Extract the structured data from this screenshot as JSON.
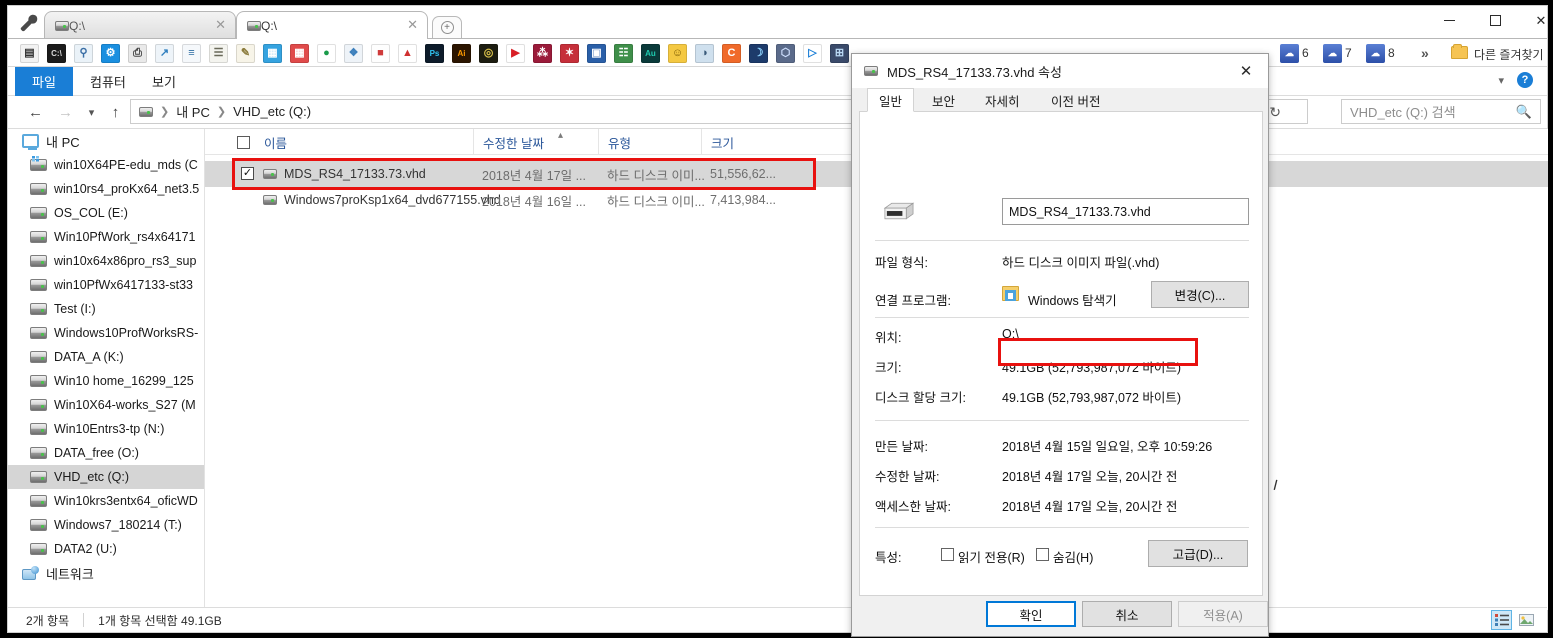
{
  "window": {
    "controls": {
      "minimize": "minimize-icon",
      "maximize": "maximize-icon",
      "close": "close-icon"
    }
  },
  "tabs": [
    {
      "label": "Q:\\",
      "active": false
    },
    {
      "label": "Q:\\",
      "active": true
    }
  ],
  "bookmarks": {
    "numbered": [
      "6",
      "7",
      "8"
    ],
    "overflow_label": "»",
    "other_folder_label": "다른 즐겨찾기"
  },
  "quicklaunch_icons": [
    "calculator-icon",
    "command-prompt-icon",
    "magnifier-icon",
    "process-explorer-icon",
    "printer-icon",
    "monitor-chart-icon",
    "spreadsheet-icon",
    "notepad-icon",
    "wordpad-icon",
    "blue-grid-icon",
    "red-grid-icon",
    "chrome-icon",
    "paint-icon",
    "media-icon",
    "pdf-icon",
    "photoshop-icon",
    "illustrator-icon",
    "camera-raw-icon",
    "play-icon",
    "app-icon-1",
    "app-icon-2",
    "snapshot-icon",
    "imaging-icon",
    "audition-icon",
    "emoji-icon",
    "globe-icon",
    "ccleaner-icon",
    "moon-icon",
    "cube-icon",
    "player-icon",
    "utility-icon"
  ],
  "ribbon": {
    "tabs": [
      {
        "label": "파일",
        "active": true
      },
      {
        "label": "컴퓨터",
        "active": false
      },
      {
        "label": "보기",
        "active": false
      }
    ],
    "help_icon": "help-icon",
    "expand_icon": "chevron-down-icon"
  },
  "address": {
    "back_icon": "back-arrow-icon",
    "forward_icon": "forward-arrow-icon",
    "history_icon": "chevron-down-icon",
    "up_icon": "up-arrow-icon",
    "breadcrumbs": [
      "내 PC",
      "VHD_etc (Q:)"
    ],
    "refresh_icon": "refresh-icon",
    "dropdown_icon": "chevron-down-icon",
    "search_placeholder": "VHD_etc (Q:) 검색",
    "search_icon": "search-icon"
  },
  "navpane": {
    "items": [
      {
        "label": "내 PC",
        "icon": "pc-icon",
        "kind": "root",
        "selected": false
      },
      {
        "label": "win10X64PE-edu_mds (C",
        "icon": "system-drive-icon",
        "kind": "drive",
        "selected": false
      },
      {
        "label": "win10rs4_proKx64_net3.5",
        "icon": "drive-icon",
        "kind": "drive",
        "selected": false
      },
      {
        "label": "OS_COL (E:)",
        "icon": "drive-icon",
        "kind": "drive",
        "selected": false
      },
      {
        "label": "Win10PfWork_rs4x64171",
        "icon": "drive-icon",
        "kind": "drive",
        "selected": false
      },
      {
        "label": "win10x64x86pro_rs3_sup",
        "icon": "drive-icon",
        "kind": "drive",
        "selected": false
      },
      {
        "label": "win10PfWx6417133-st33",
        "icon": "drive-icon",
        "kind": "drive",
        "selected": false
      },
      {
        "label": "Test (I:)",
        "icon": "drive-icon",
        "kind": "drive",
        "selected": false
      },
      {
        "label": "Windows10ProfWorksRS-",
        "icon": "drive-icon",
        "kind": "drive",
        "selected": false
      },
      {
        "label": "DATA_A (K:)",
        "icon": "drive-icon",
        "kind": "drive",
        "selected": false
      },
      {
        "label": "Win10 home_16299_125",
        "icon": "drive-icon",
        "kind": "drive",
        "selected": false
      },
      {
        "label": "Win10X64-works_S27 (M",
        "icon": "drive-icon",
        "kind": "drive",
        "selected": false
      },
      {
        "label": "Win10Entrs3-tp (N:)",
        "icon": "drive-icon",
        "kind": "drive",
        "selected": false
      },
      {
        "label": "DATA_free (O:)",
        "icon": "drive-icon",
        "kind": "drive",
        "selected": false
      },
      {
        "label": "VHD_etc (Q:)",
        "icon": "drive-icon",
        "kind": "drive",
        "selected": true
      },
      {
        "label": "Win10krs3entx64_oficWD",
        "icon": "drive-icon",
        "kind": "drive",
        "selected": false
      },
      {
        "label": "Windows7_180214 (T:)",
        "icon": "drive-icon",
        "kind": "drive",
        "selected": false
      },
      {
        "label": "DATA2 (U:)",
        "icon": "drive-icon",
        "kind": "drive",
        "selected": false
      },
      {
        "label": "네트워크",
        "icon": "network-icon",
        "kind": "root",
        "selected": false
      }
    ],
    "scrollbar": {
      "up_icon": "chevron-up-icon",
      "down_icon": "chevron-down-icon"
    }
  },
  "filelist": {
    "columns": [
      {
        "label": "이름"
      },
      {
        "label": "수정한 날짜"
      },
      {
        "label": "유형"
      },
      {
        "label": "크기"
      }
    ],
    "sort_indicator": "sort-ascending-icon",
    "rows": [
      {
        "name": "MDS_RS4_17133.73.vhd",
        "date": "2018년 4월 17일 ...",
        "type": "하드 디스크 이미...",
        "size": "51,556,62...",
        "selected": true,
        "checked": true
      },
      {
        "name": "Windows7proKsp1x64_dvd677155.vhd",
        "date": "2018년 4월 16일 ...",
        "type": "하드 디스크 이미...",
        "size": "7,413,984...",
        "selected": false,
        "checked": false
      }
    ]
  },
  "statusbar": {
    "item_count": "2개 항목",
    "selection": "1개 항목 선택함 49.1GB",
    "details_view_icon": "details-view-icon",
    "large_icons_view_icon": "large-icons-view-icon"
  },
  "dialog": {
    "title": "MDS_RS4_17133.73.vhd 속성",
    "title_icon": "vhd-drive-icon",
    "close_icon": "close-icon",
    "tabs": [
      {
        "label": "일반",
        "active": true
      },
      {
        "label": "보안",
        "active": false
      },
      {
        "label": "자세히",
        "active": false
      },
      {
        "label": "이전 버전",
        "active": false
      }
    ],
    "filename": "MDS_RS4_17133.73.vhd",
    "file_icon": "vhd-drive-icon",
    "fields": [
      {
        "label": "파일 형식:",
        "value": "하드 디스크 이미지 파일(.vhd)"
      },
      {
        "label": "연결 프로그램:",
        "value": "Windows 탐색기"
      },
      {
        "label": "위치:",
        "value": "Q:\\"
      },
      {
        "label": "크기:",
        "value": "49.1GB (52,793,987,072 바이트)"
      },
      {
        "label": "디스크 할당 크기:",
        "value": "49.1GB (52,793,987,072 바이트)"
      },
      {
        "label": "만든 날짜:",
        "value": "2018년 4월 15일 일요일, 오후 10:59:26"
      },
      {
        "label": "수정한 날짜:",
        "value": "2018년 4월 17일 오늘, 20시간 전"
      },
      {
        "label": "액세스한 날짜:",
        "value": "2018년 4월 17일 오늘, 20시간 전"
      }
    ],
    "change_button": "변경(C)...",
    "attributes_label": "특성:",
    "readonly_label": "읽기 전용(R)",
    "hidden_label": "숨김(H)",
    "advanced_button": "고급(D)...",
    "ok_button": "확인",
    "cancel_button": "취소",
    "apply_button": "적용(A)"
  },
  "annotations": {
    "accent_red": "#e8110f",
    "accent_blue": "#0078d7"
  }
}
